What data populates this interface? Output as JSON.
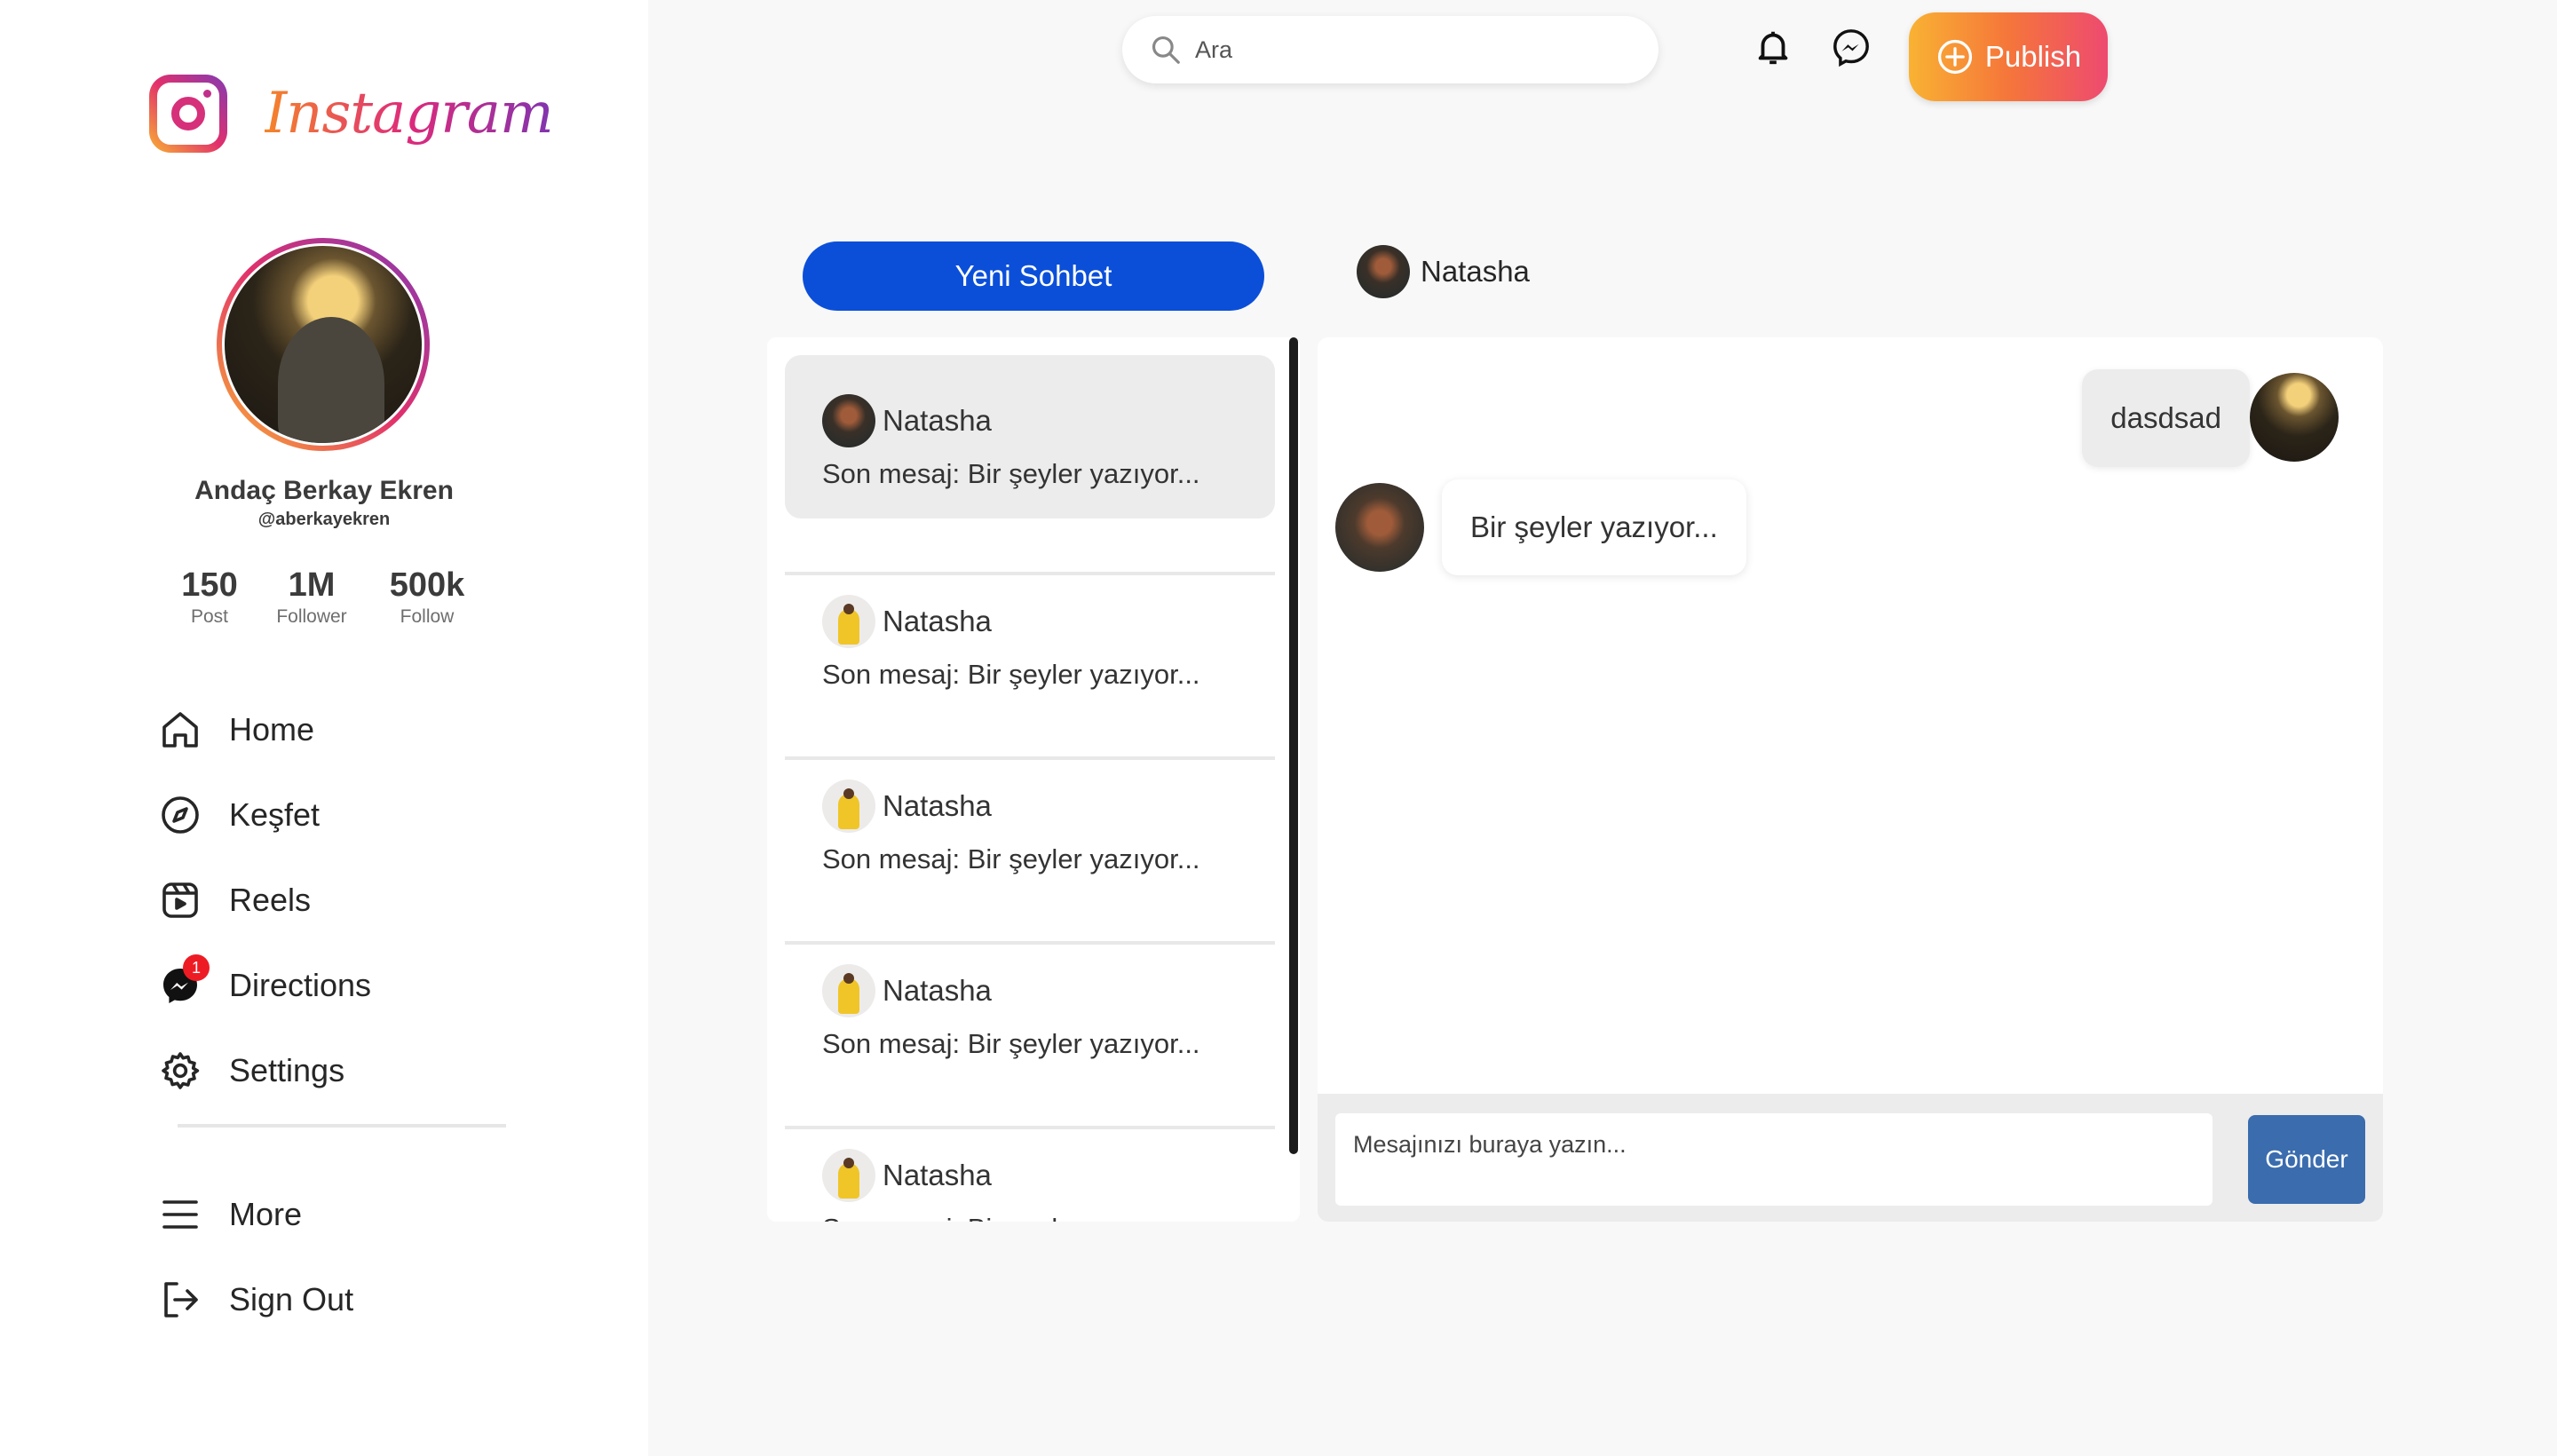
{
  "brand": {
    "name": "Instagram"
  },
  "profile": {
    "name": "Andaç Berkay Ekren",
    "handle": "@aberkayekren",
    "stats": [
      {
        "value": "150",
        "label": "Post"
      },
      {
        "value": "1M",
        "label": "Follower"
      },
      {
        "value": "500k",
        "label": "Follow"
      }
    ]
  },
  "nav": {
    "items": [
      {
        "label": "Home",
        "icon": "home-icon"
      },
      {
        "label": "Keşfet",
        "icon": "compass-icon"
      },
      {
        "label": "Reels",
        "icon": "reels-icon"
      },
      {
        "label": "Directions",
        "icon": "messenger-icon",
        "badge": "1"
      },
      {
        "label": "Settings",
        "icon": "gear-icon"
      }
    ],
    "secondary": [
      {
        "label": "More",
        "icon": "menu-icon"
      },
      {
        "label": "Sign Out",
        "icon": "sign-out-icon"
      }
    ]
  },
  "topbar": {
    "search_placeholder": "Ara",
    "publish_label": "Publish"
  },
  "chat": {
    "new_chat_label": "Yeni Sohbet",
    "active_contact": "Natasha",
    "list": [
      {
        "name": "Natasha",
        "last": "Son mesaj: Bir şeyler yazıyor..."
      },
      {
        "name": "Natasha",
        "last": "Son mesaj: Bir şeyler yazıyor..."
      },
      {
        "name": "Natasha",
        "last": "Son mesaj: Bir şeyler yazıyor..."
      },
      {
        "name": "Natasha",
        "last": "Son mesaj: Bir şeyler yazıyor..."
      },
      {
        "name": "Natasha",
        "last": "Son mesaj: Bir şeyler yazıyor..."
      }
    ],
    "messages": [
      {
        "from": "me",
        "text": "dasdsad"
      },
      {
        "from": "them",
        "text": "Bir şeyler yazıyor..."
      }
    ],
    "composer_placeholder": "Mesajınızı buraya yazın...",
    "send_label": "Gönder"
  },
  "colors": {
    "primary_blue": "#0b4fd9",
    "send_blue": "#3a6cae",
    "badge_red": "#ed1c24"
  }
}
